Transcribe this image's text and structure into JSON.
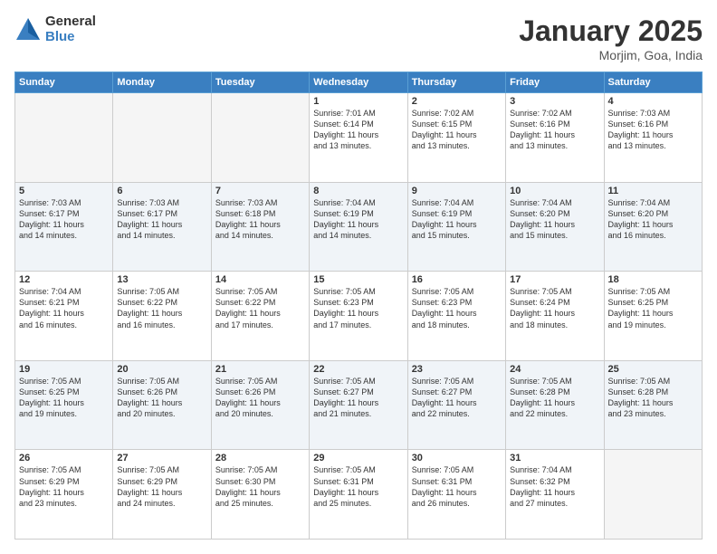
{
  "header": {
    "logo_general": "General",
    "logo_blue": "Blue",
    "month": "January 2025",
    "location": "Morjim, Goa, India"
  },
  "weekdays": [
    "Sunday",
    "Monday",
    "Tuesday",
    "Wednesday",
    "Thursday",
    "Friday",
    "Saturday"
  ],
  "weeks": [
    [
      {
        "day": "",
        "info": ""
      },
      {
        "day": "",
        "info": ""
      },
      {
        "day": "",
        "info": ""
      },
      {
        "day": "1",
        "info": "Sunrise: 7:01 AM\nSunset: 6:14 PM\nDaylight: 11 hours\nand 13 minutes."
      },
      {
        "day": "2",
        "info": "Sunrise: 7:02 AM\nSunset: 6:15 PM\nDaylight: 11 hours\nand 13 minutes."
      },
      {
        "day": "3",
        "info": "Sunrise: 7:02 AM\nSunset: 6:16 PM\nDaylight: 11 hours\nand 13 minutes."
      },
      {
        "day": "4",
        "info": "Sunrise: 7:03 AM\nSunset: 6:16 PM\nDaylight: 11 hours\nand 13 minutes."
      }
    ],
    [
      {
        "day": "5",
        "info": "Sunrise: 7:03 AM\nSunset: 6:17 PM\nDaylight: 11 hours\nand 14 minutes."
      },
      {
        "day": "6",
        "info": "Sunrise: 7:03 AM\nSunset: 6:17 PM\nDaylight: 11 hours\nand 14 minutes."
      },
      {
        "day": "7",
        "info": "Sunrise: 7:03 AM\nSunset: 6:18 PM\nDaylight: 11 hours\nand 14 minutes."
      },
      {
        "day": "8",
        "info": "Sunrise: 7:04 AM\nSunset: 6:19 PM\nDaylight: 11 hours\nand 14 minutes."
      },
      {
        "day": "9",
        "info": "Sunrise: 7:04 AM\nSunset: 6:19 PM\nDaylight: 11 hours\nand 15 minutes."
      },
      {
        "day": "10",
        "info": "Sunrise: 7:04 AM\nSunset: 6:20 PM\nDaylight: 11 hours\nand 15 minutes."
      },
      {
        "day": "11",
        "info": "Sunrise: 7:04 AM\nSunset: 6:20 PM\nDaylight: 11 hours\nand 16 minutes."
      }
    ],
    [
      {
        "day": "12",
        "info": "Sunrise: 7:04 AM\nSunset: 6:21 PM\nDaylight: 11 hours\nand 16 minutes."
      },
      {
        "day": "13",
        "info": "Sunrise: 7:05 AM\nSunset: 6:22 PM\nDaylight: 11 hours\nand 16 minutes."
      },
      {
        "day": "14",
        "info": "Sunrise: 7:05 AM\nSunset: 6:22 PM\nDaylight: 11 hours\nand 17 minutes."
      },
      {
        "day": "15",
        "info": "Sunrise: 7:05 AM\nSunset: 6:23 PM\nDaylight: 11 hours\nand 17 minutes."
      },
      {
        "day": "16",
        "info": "Sunrise: 7:05 AM\nSunset: 6:23 PM\nDaylight: 11 hours\nand 18 minutes."
      },
      {
        "day": "17",
        "info": "Sunrise: 7:05 AM\nSunset: 6:24 PM\nDaylight: 11 hours\nand 18 minutes."
      },
      {
        "day": "18",
        "info": "Sunrise: 7:05 AM\nSunset: 6:25 PM\nDaylight: 11 hours\nand 19 minutes."
      }
    ],
    [
      {
        "day": "19",
        "info": "Sunrise: 7:05 AM\nSunset: 6:25 PM\nDaylight: 11 hours\nand 19 minutes."
      },
      {
        "day": "20",
        "info": "Sunrise: 7:05 AM\nSunset: 6:26 PM\nDaylight: 11 hours\nand 20 minutes."
      },
      {
        "day": "21",
        "info": "Sunrise: 7:05 AM\nSunset: 6:26 PM\nDaylight: 11 hours\nand 20 minutes."
      },
      {
        "day": "22",
        "info": "Sunrise: 7:05 AM\nSunset: 6:27 PM\nDaylight: 11 hours\nand 21 minutes."
      },
      {
        "day": "23",
        "info": "Sunrise: 7:05 AM\nSunset: 6:27 PM\nDaylight: 11 hours\nand 22 minutes."
      },
      {
        "day": "24",
        "info": "Sunrise: 7:05 AM\nSunset: 6:28 PM\nDaylight: 11 hours\nand 22 minutes."
      },
      {
        "day": "25",
        "info": "Sunrise: 7:05 AM\nSunset: 6:28 PM\nDaylight: 11 hours\nand 23 minutes."
      }
    ],
    [
      {
        "day": "26",
        "info": "Sunrise: 7:05 AM\nSunset: 6:29 PM\nDaylight: 11 hours\nand 23 minutes."
      },
      {
        "day": "27",
        "info": "Sunrise: 7:05 AM\nSunset: 6:29 PM\nDaylight: 11 hours\nand 24 minutes."
      },
      {
        "day": "28",
        "info": "Sunrise: 7:05 AM\nSunset: 6:30 PM\nDaylight: 11 hours\nand 25 minutes."
      },
      {
        "day": "29",
        "info": "Sunrise: 7:05 AM\nSunset: 6:31 PM\nDaylight: 11 hours\nand 25 minutes."
      },
      {
        "day": "30",
        "info": "Sunrise: 7:05 AM\nSunset: 6:31 PM\nDaylight: 11 hours\nand 26 minutes."
      },
      {
        "day": "31",
        "info": "Sunrise: 7:04 AM\nSunset: 6:32 PM\nDaylight: 11 hours\nand 27 minutes."
      },
      {
        "day": "",
        "info": ""
      }
    ]
  ]
}
